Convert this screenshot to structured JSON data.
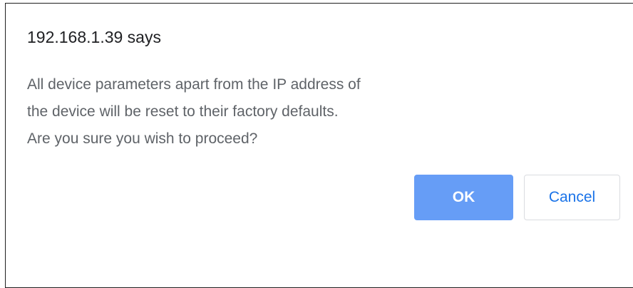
{
  "dialog": {
    "title": "192.168.1.39 says",
    "message_lines": [
      "All device parameters apart from the IP address of",
      "the device will be reset to their factory defaults.",
      "Are you sure you wish to proceed?"
    ],
    "ok_label": "OK",
    "cancel_label": "Cancel"
  },
  "colors": {
    "ok_button": "#669df6",
    "cancel_text": "#1a73e8",
    "message_text": "#5f6368",
    "title_text": "#202124"
  }
}
